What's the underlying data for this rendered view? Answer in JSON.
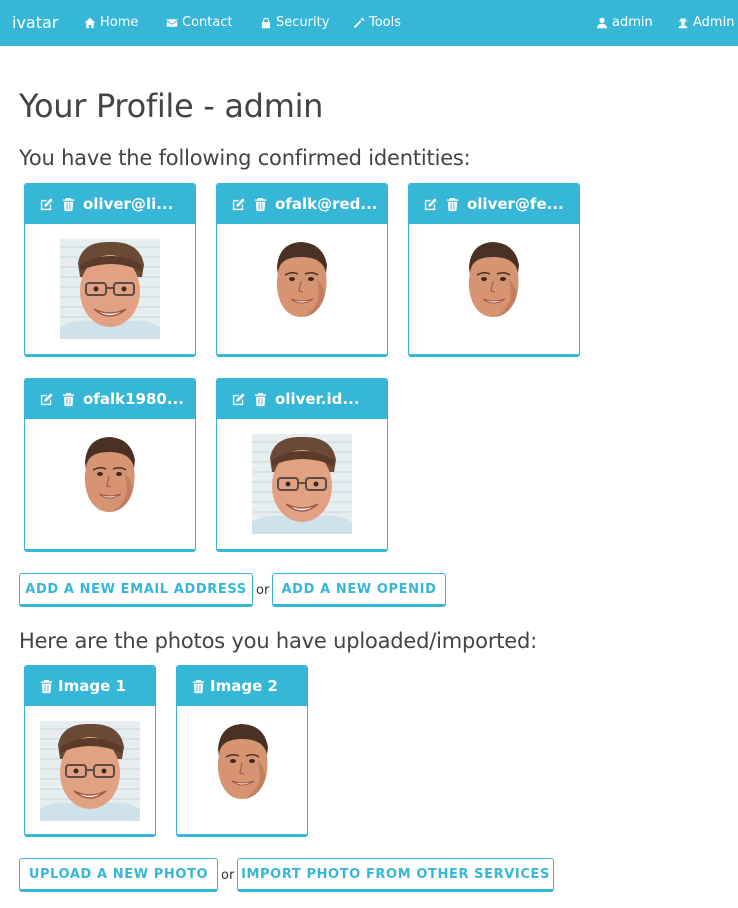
{
  "navbar": {
    "brand": "ivatar",
    "links": [
      {
        "label": "Home",
        "icon": "home-icon"
      },
      {
        "label": "Contact",
        "icon": "envelope-icon"
      },
      {
        "label": "Security",
        "icon": "lock-icon"
      },
      {
        "label": "Tools",
        "icon": "wrench-icon"
      }
    ],
    "right": [
      {
        "label": "admin",
        "icon": "user-icon"
      },
      {
        "label": "Admin",
        "icon": "user-secret-icon"
      }
    ]
  },
  "page": {
    "title": "Your Profile - admin",
    "identities_heading": "You have the following confirmed identities:",
    "photos_heading": "Here are the photos you have uploaded/imported:"
  },
  "identities": [
    {
      "label": "oliver@li...",
      "avatar": "photo"
    },
    {
      "label": "ofalk@red...",
      "avatar": "face-cutout"
    },
    {
      "label": "oliver@fe...",
      "avatar": "face-cutout"
    },
    {
      "label": "ofalk1980...",
      "avatar": "face-cutout"
    },
    {
      "label": "oliver.id...",
      "avatar": "photo"
    }
  ],
  "identity_actions": {
    "add_email": "ADD A NEW EMAIL ADDRESS",
    "or": "or",
    "add_openid": "ADD A NEW OPENID"
  },
  "photos": [
    {
      "label": "Image 1",
      "avatar": "photo"
    },
    {
      "label": "Image 2",
      "avatar": "face-cutout"
    }
  ],
  "photo_actions": {
    "upload": "UPLOAD A NEW PHOTO",
    "or": "or",
    "import": "IMPORT PHOTO FROM OTHER SERVICES"
  },
  "colors": {
    "accent": "#36b7d7",
    "text": "#444444"
  }
}
